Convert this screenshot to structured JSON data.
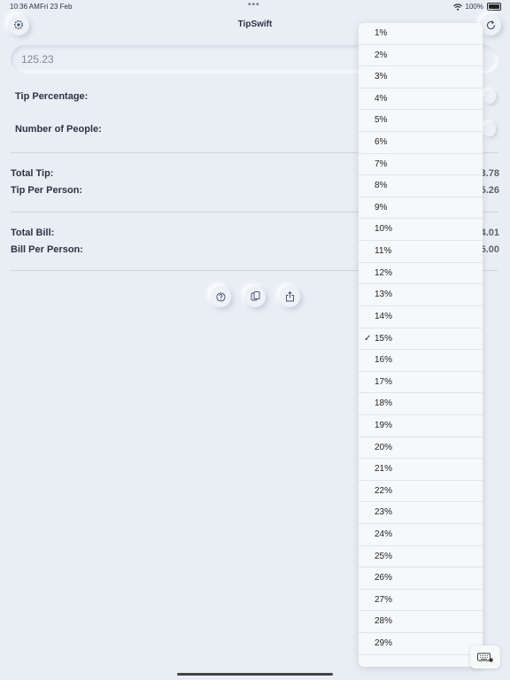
{
  "status_bar": {
    "time": "10:36 AM",
    "date": "Fri 23 Feb",
    "battery": "100%"
  },
  "header": {
    "title": "TipSwift",
    "settings_icon": "gear-icon",
    "reset_icon": "refresh-icon"
  },
  "bill": {
    "value": "125.23"
  },
  "labels": {
    "tip_percentage": "Tip Percentage:",
    "number_of_people": "Number of People:",
    "total_tip": "Total Tip:",
    "tip_per_person": "Tip Per Person:",
    "total_bill": "Total Bill:",
    "bill_per_person": "Bill Per Person:"
  },
  "values": {
    "total_tip": "3.78",
    "tip_per_person": "5.26",
    "total_bill": "4.01",
    "bill_per_person": "5.00"
  },
  "actions": {
    "help_icon": "question-icon",
    "copy_icon": "copy-icon",
    "share_icon": "share-icon"
  },
  "tip_options": [
    "1%",
    "2%",
    "3%",
    "4%",
    "5%",
    "6%",
    "7%",
    "8%",
    "9%",
    "10%",
    "11%",
    "12%",
    "13%",
    "14%",
    "15%",
    "16%",
    "17%",
    "18%",
    "19%",
    "20%",
    "21%",
    "22%",
    "23%",
    "24%",
    "25%",
    "26%",
    "27%",
    "28%",
    "29%"
  ],
  "selected_tip": "15%",
  "keyboard_icon": "keyboard-icon"
}
